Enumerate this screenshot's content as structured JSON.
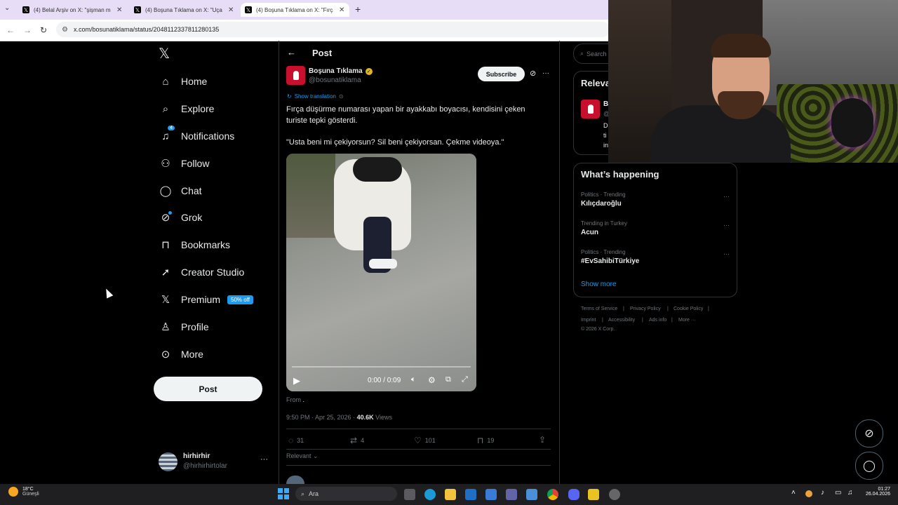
{
  "browser": {
    "tabs": [
      {
        "label": "(4) Belal Arşiv on X: \"şişman me",
        "active": false
      },
      {
        "label": "(4) Boşuna Tıklama on X: \"Uçak",
        "active": false
      },
      {
        "label": "(4) Boşuna Tıklama on X: \"Fırça",
        "active": true
      }
    ],
    "url": "x.com/bosunatiklama/status/2048112337811280135"
  },
  "nav": {
    "items": [
      {
        "label": "Home",
        "icon": "home-icon"
      },
      {
        "label": "Explore",
        "icon": "search-icon"
      },
      {
        "label": "Notifications",
        "icon": "bell-icon",
        "count": "4"
      },
      {
        "label": "Follow",
        "icon": "follow-icon"
      },
      {
        "label": "Chat",
        "icon": "chat-icon"
      },
      {
        "label": "Grok",
        "icon": "grok-icon"
      },
      {
        "label": "Bookmarks",
        "icon": "bookmark-icon"
      },
      {
        "label": "Creator Studio",
        "icon": "rocket-icon"
      },
      {
        "label": "Premium",
        "icon": "x-logo-icon",
        "badge": "50% off"
      },
      {
        "label": "Profile",
        "icon": "person-icon"
      },
      {
        "label": "More",
        "icon": "more-circle-icon"
      }
    ],
    "post_button": "Post",
    "account": {
      "name": "hirhirhir",
      "handle": "@hirhirhirtolar"
    }
  },
  "post": {
    "header_title": "Post",
    "author": "Boşuna Tıklama",
    "handle": "@bosunatiklama",
    "subscribe": "Subscribe",
    "show_translation": "Show translation",
    "text1": "Fırça düşürme numarası yapan bir ayakkabı boyacısı, kendisini çeken turiste tepki gösterdi.",
    "text2": "\"Usta beni mi çekiyorsun? Sil beni çekiyorsan. Çekme videoya.\"",
    "video_time": "0:00 / 0:09",
    "video_progress": 0,
    "from_label": "From",
    "from_value": ".",
    "timestamp": "9:50 PM · Apr 25, 2026 ·",
    "views_count": "40.6K",
    "views_label": "Views",
    "replies": "31",
    "reposts": "4",
    "likes": "101",
    "bookmarks": "19",
    "sort": "Relevant"
  },
  "right": {
    "search_placeholder": "Search",
    "relevant_title": "Relevant people",
    "whats_happening": "What’s happening",
    "trends": [
      {
        "meta": "Politics · Trending",
        "name": "Kılıçdaroğlu"
      },
      {
        "meta": "Trending in Turkey",
        "name": "Acun"
      },
      {
        "meta": "Politics · Trending",
        "name": "#EvSahibiTürkiye"
      }
    ],
    "show_more": "Show more",
    "footer": [
      "Terms of Service",
      "Privacy Policy",
      "Cookie Policy",
      "Imprint",
      "Accessibility",
      "Ads info",
      "More ···"
    ],
    "copyright": "© 2026 X Corp."
  },
  "taskbar": {
    "temp": "18°C",
    "weather": "Güneşli",
    "search_placeholder": "Ara",
    "time": "01:27",
    "date": "26.04.2026"
  },
  "colors": {
    "accent": "#1d9bf0",
    "verified": "#e2b719",
    "tab_bar": "#e8ddf7"
  }
}
